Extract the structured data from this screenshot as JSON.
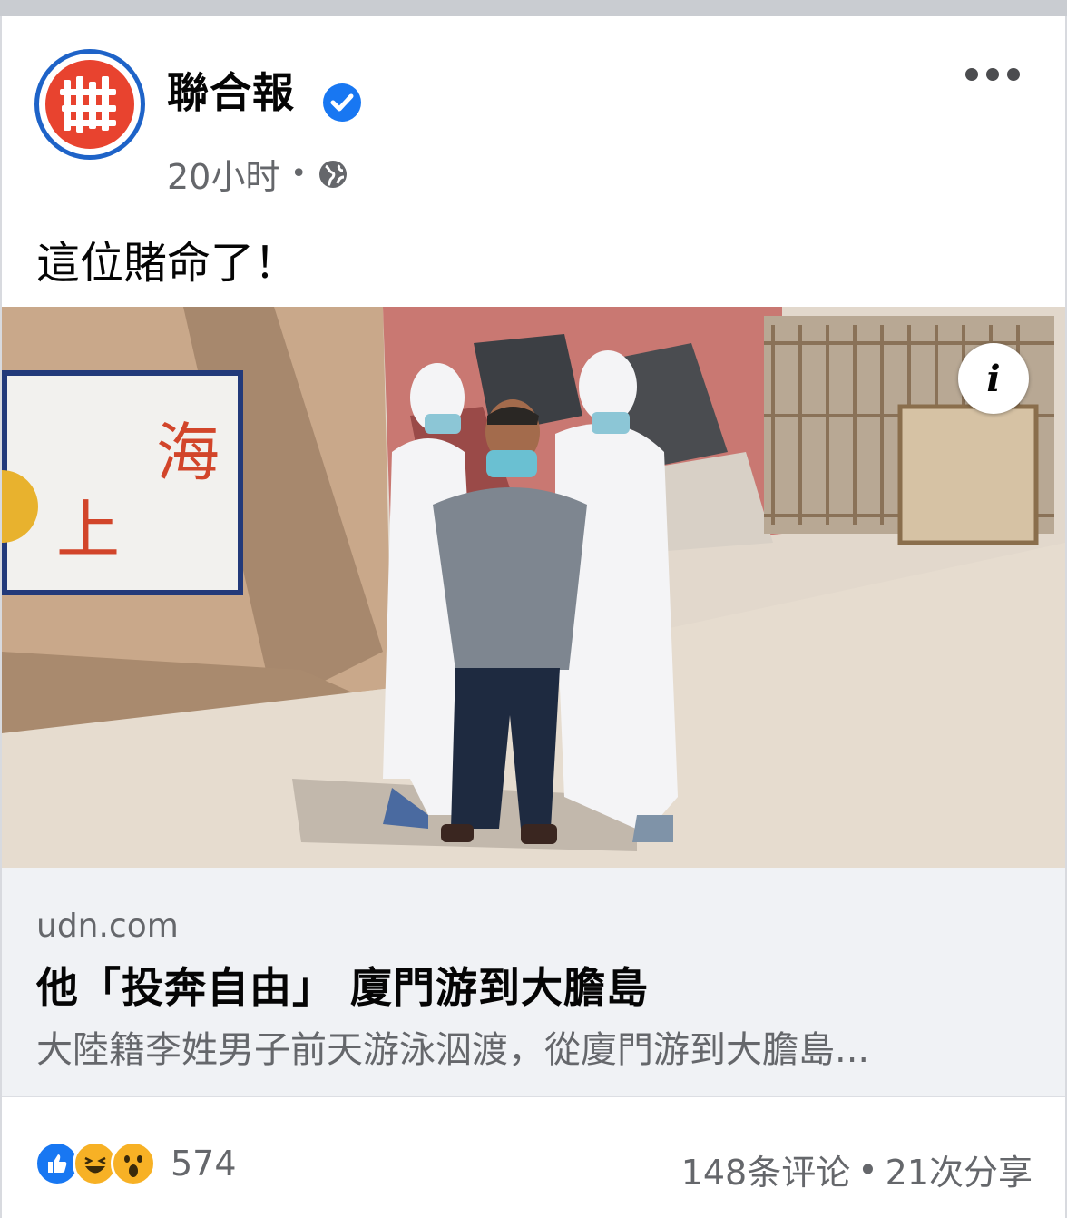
{
  "post": {
    "page_name": "聯合報",
    "time": "20小时",
    "meta_separator": "•",
    "privacy_icon": "globe-icon",
    "text": "這位賭命了！"
  },
  "link_preview": {
    "domain": "udn.com",
    "headline": "他「投奔自由」 廈門游到大膽島",
    "description": "大陸籍李姓男子前天游泳泅渡，從廈門游到大膽島..."
  },
  "photo": {
    "wall_text_1": "海",
    "wall_text_2": "上",
    "info_icon_label": "i"
  },
  "engagement": {
    "reaction_icons": [
      "like-icon",
      "haha-icon",
      "wow-icon"
    ],
    "reaction_count": "574",
    "comments": "148条评论",
    "separator": "•",
    "shares": "21次分享"
  },
  "colors": {
    "brand_blue": "#1877f2",
    "logo_red": "#e8432f",
    "secondary_text": "#65676b",
    "link_box_bg": "#f0f2f5"
  }
}
